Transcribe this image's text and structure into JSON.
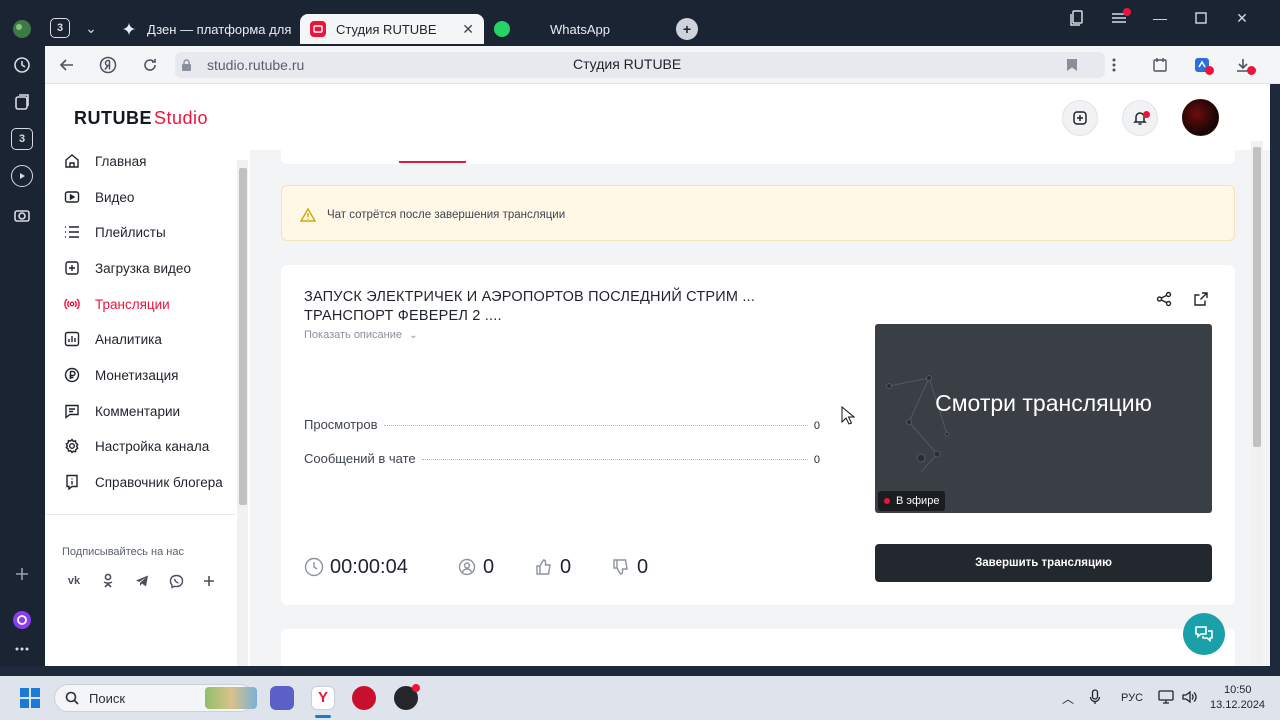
{
  "browser": {
    "tabs": [
      {
        "label": "Дзен — платформа для п"
      },
      {
        "label": "Студия RUTUBE"
      },
      {
        "label": "WhatsApp"
      }
    ],
    "rail_badges": [
      "3",
      "3"
    ],
    "url": "studio.rutube.ru",
    "page_title": "Студия RUTUBE"
  },
  "app": {
    "logo_main": "RUTUBE",
    "logo_sub": "Studio",
    "accent": "#ed143b"
  },
  "sidebar": {
    "items": [
      {
        "label": "Главная",
        "icon": "home-icon"
      },
      {
        "label": "Видео",
        "icon": "video-icon"
      },
      {
        "label": "Плейлисты",
        "icon": "playlist-icon"
      },
      {
        "label": "Загрузка видео",
        "icon": "upload-icon"
      },
      {
        "label": "Трансляции",
        "icon": "broadcast-icon",
        "active": true
      },
      {
        "label": "Аналитика",
        "icon": "analytics-icon"
      },
      {
        "label": "Монетизация",
        "icon": "monetization-icon"
      },
      {
        "label": "Комментарии",
        "icon": "comments-icon"
      },
      {
        "label": "Настройка канала",
        "icon": "settings-icon"
      },
      {
        "label": "Справочник блогера",
        "icon": "guide-icon"
      }
    ],
    "follow_title": "Подписывайтесь на нас",
    "socials": [
      "vk-icon",
      "ok-icon",
      "telegram-icon",
      "viber-icon",
      "plus-icon"
    ]
  },
  "warning": {
    "text": "Чат сотрётся после завершения трансляции"
  },
  "stream": {
    "title": "ЗАПУСК ЭЛЕКТРИЧЕК И АЭРОПОРТОВ ПОСЛЕДНИЙ СТРИМ ... ТРАНСПОРТ ФЕВЕРЕЛ 2 ....",
    "show_description": "Показать описание",
    "stats": [
      {
        "label": "Просмотров",
        "value": "0"
      },
      {
        "label": "Сообщений в чате",
        "value": "0"
      }
    ],
    "preview_text": "Смотри трансляцию",
    "live_badge": "В эфире",
    "end_button": "Завершить трансляцию",
    "duration": "00:00:04",
    "viewers": "0",
    "likes": "0",
    "dislikes": "0"
  },
  "taskbar": {
    "search_placeholder": "Поиск",
    "lang": "РУС",
    "time": "10:50",
    "date": "13.12.2024"
  }
}
